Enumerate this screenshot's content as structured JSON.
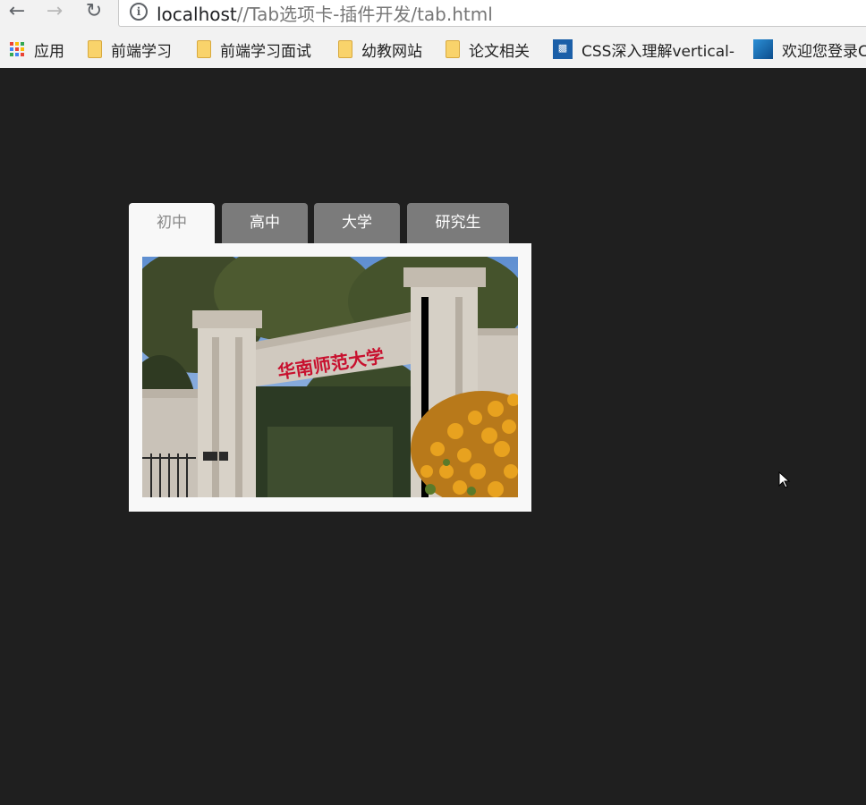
{
  "browser": {
    "url_host": "localhost",
    "url_path": "//Tab选项卡-插件开发/tab.html"
  },
  "bookmarks": [
    {
      "label": "应用",
      "icon": "apps-icon"
    },
    {
      "label": "前端学习",
      "icon": "folder-icon"
    },
    {
      "label": "前端学习面试",
      "icon": "folder-icon"
    },
    {
      "label": "幼教网站",
      "icon": "folder-icon"
    },
    {
      "label": "论文相关",
      "icon": "folder-icon"
    },
    {
      "label": "CSS深入理解vertical-",
      "icon": "site-icon"
    },
    {
      "label": "欢迎您登录C",
      "icon": "site-icon"
    }
  ],
  "tabs": [
    {
      "label": "初中",
      "active": true
    },
    {
      "label": "高中",
      "active": false
    },
    {
      "label": "大学",
      "active": false
    },
    {
      "label": "研究生",
      "active": false
    }
  ],
  "panel": {
    "gate_inscription": "华南师范大学"
  },
  "colors": {
    "page_bg": "#1f1f1f",
    "tab_inactive": "#7b7b7b",
    "tab_active": "#f8f8f8",
    "panel_bg": "#f8f8f8"
  }
}
